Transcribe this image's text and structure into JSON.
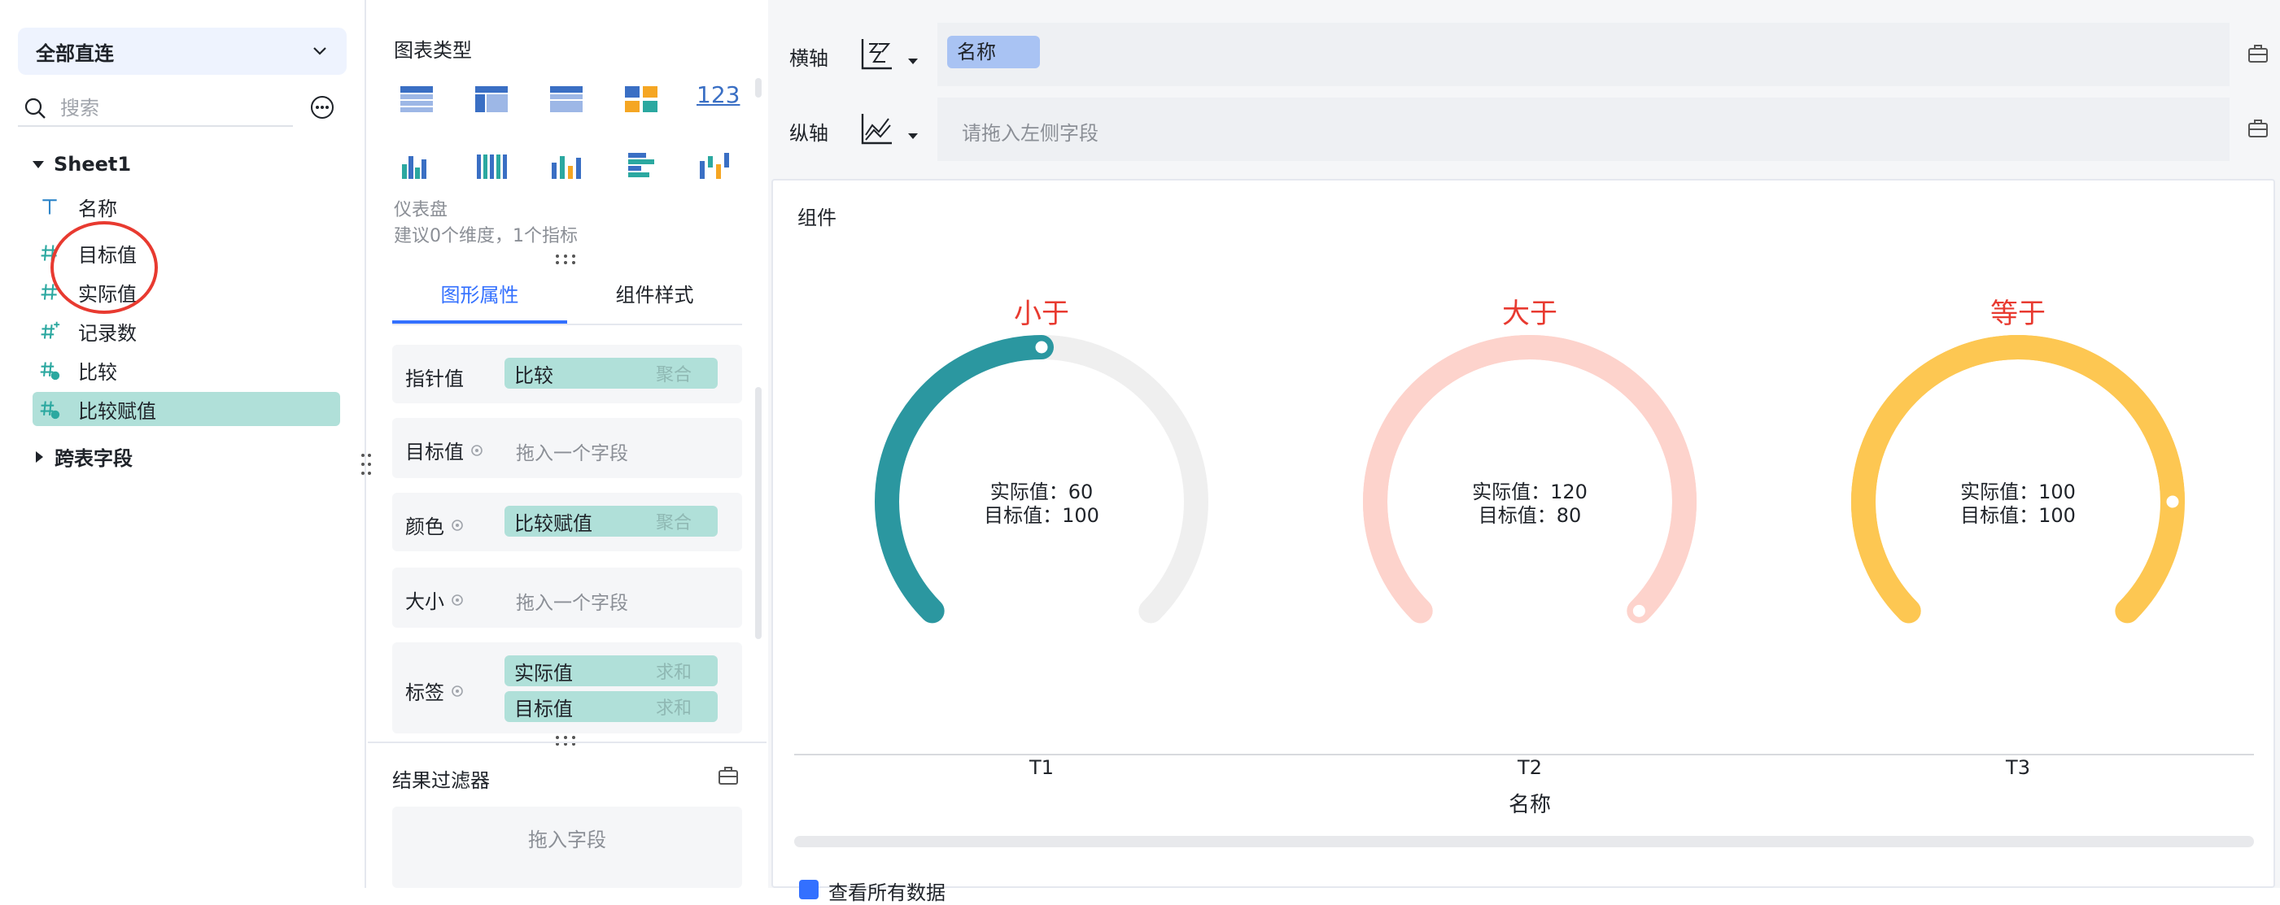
{
  "datasource": {
    "label": "全部直连"
  },
  "search": {
    "placeholder": "搜索"
  },
  "tree": {
    "root": "Sheet1",
    "fields": [
      {
        "label": "名称",
        "type": "text"
      },
      {
        "label": "目标值",
        "type": "number"
      },
      {
        "label": "实际值",
        "type": "number"
      },
      {
        "label": "记录数",
        "type": "number-star"
      },
      {
        "label": "比较",
        "type": "number-calc"
      },
      {
        "label": "比较赋值",
        "type": "number-calc"
      }
    ],
    "cross_table": "跨表字段"
  },
  "chart_types": {
    "title": "图表类型",
    "selected_name": "仪表盘",
    "selected_hint": "建议0个维度，1个指标",
    "number_icon_label": "123"
  },
  "tabs": [
    "图形属性",
    "组件样式"
  ],
  "properties": {
    "pointer": {
      "label": "指针值",
      "field": "比较",
      "agg": "聚合"
    },
    "target": {
      "label": "目标值",
      "hint": "拖入一个字段"
    },
    "color": {
      "label": "颜色",
      "field": "比较赋值",
      "agg": "聚合"
    },
    "size": {
      "label": "大小",
      "hint": "拖入一个字段"
    },
    "tags": {
      "label": "标签",
      "fields": [
        {
          "field": "实际值",
          "agg": "求和"
        },
        {
          "field": "目标值",
          "agg": "求和"
        }
      ]
    }
  },
  "result_filter": {
    "title": "结果过滤器",
    "hint": "拖入字段"
  },
  "axes": {
    "x": {
      "label": "横轴",
      "field": "名称"
    },
    "y": {
      "label": "纵轴",
      "hint": "请拖入左侧字段"
    }
  },
  "component": {
    "title": "组件",
    "x_axis_title": "名称",
    "partial_label": "查看所有数据"
  },
  "chart_data": {
    "type": "gauge",
    "xlabel": "名称",
    "categories": [
      "T1",
      "T2",
      "T3"
    ],
    "gauges": [
      {
        "category": "T1",
        "title": "小于",
        "actual_label": "实际值：60",
        "target_label": "目标值：100",
        "actual": 60,
        "target": 100,
        "color": "#2b97a0",
        "track": "#efefef"
      },
      {
        "category": "T2",
        "title": "大于",
        "actual_label": "实际值：120",
        "target_label": "目标值：80",
        "actual": 120,
        "target": 80,
        "color": "#fdd3cc",
        "track": "#fdd3cc"
      },
      {
        "category": "T3",
        "title": "等于",
        "actual_label": "实际值：100",
        "target_label": "目标值：100",
        "actual": 100,
        "target": 100,
        "color": "#fdc752",
        "track": "#fdc752"
      }
    ],
    "title_color": "#e83a30"
  }
}
